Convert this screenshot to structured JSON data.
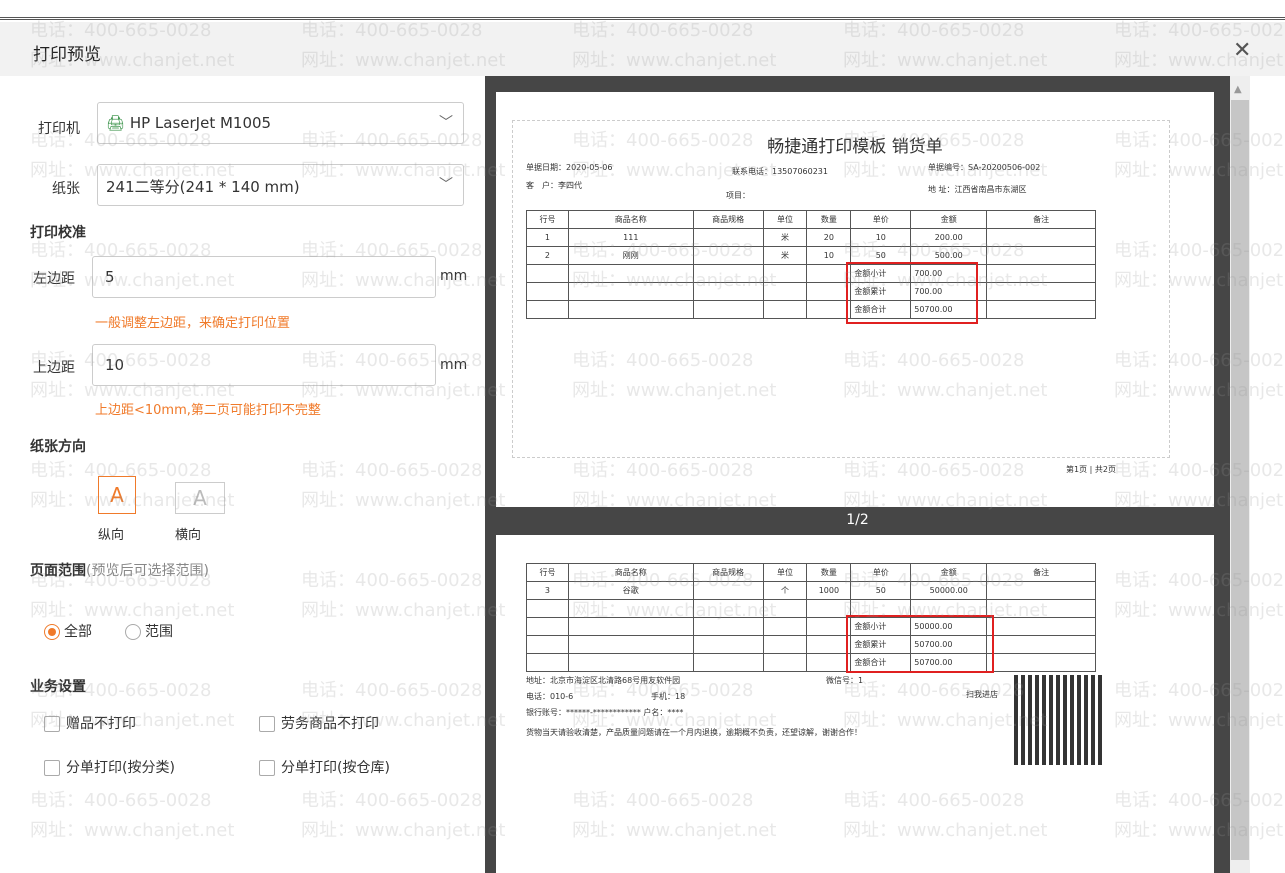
{
  "dialog": {
    "title": "打印预览",
    "close_icon": "close-icon"
  },
  "watermark": {
    "line1": "电话：400-665-0028",
    "line2": "网址：www.chanjet.net"
  },
  "settings": {
    "printer_label": "打印机",
    "printer_value": "HP LaserJet M1005",
    "paper_label": "纸张",
    "paper_value": "241二等分(241 * 140 mm)",
    "calibration_title": "打印校准",
    "left_margin_label": "左边距",
    "left_margin_value": "5",
    "left_margin_unit": "mm",
    "left_margin_hint": "一般调整左边距，来确定打印位置",
    "top_margin_label": "上边距",
    "top_margin_value": "10",
    "top_margin_unit": "mm",
    "top_margin_hint": "上边距<10mm,第二页可能打印不完整",
    "orientation_title": "纸张方向",
    "portrait_label": "纵向",
    "landscape_label": "横向",
    "orientation_glyph": "A",
    "orientation_selected": "portrait",
    "range_title": "页面范围",
    "range_note": "(预览后可选择范围)",
    "range_all": "全部",
    "range_custom": "范围",
    "range_selected": "all",
    "business_title": "业务设置",
    "options": [
      {
        "label": "赠品不打印",
        "checked": false
      },
      {
        "label": "劳务商品不打印",
        "checked": false
      },
      {
        "label": "分单打印(按分类)",
        "checked": false
      },
      {
        "label": "分单打印(按仓库)",
        "checked": false
      }
    ]
  },
  "preview": {
    "page_indicator": "1/2",
    "doc_title": "畅捷通打印模板 销货单",
    "date": "单据日期：2020-05-06",
    "phone": "联系电话：13507060231",
    "doc_no": "单据编号：SA-20200506-002",
    "customer": "客　户：李四代",
    "address": "地 址：江西省南昌市东湖区",
    "project": "项目：",
    "headers": [
      "行号",
      "商品名称",
      "商品规格",
      "单位",
      "数量",
      "单价",
      "金额",
      "备注"
    ],
    "page1_rows": [
      [
        "1",
        "111",
        "",
        "米",
        "20",
        "10",
        "200.00",
        ""
      ],
      [
        "2",
        "刚刚",
        "",
        "米",
        "10",
        "50",
        "500.00",
        ""
      ]
    ],
    "page1_totals": [
      [
        "金额小计",
        "700.00"
      ],
      [
        "金额累计",
        "700.00"
      ],
      [
        "金额合计",
        "50700.00"
      ]
    ],
    "page1_footer": "第1页 | 共2页",
    "page2_rows": [
      [
        "3",
        "谷歌",
        "",
        "个",
        "1000",
        "50",
        "50000.00",
        ""
      ]
    ],
    "page2_totals": [
      [
        "金额小计",
        "50000.00"
      ],
      [
        "金额累计",
        "50700.00"
      ],
      [
        "金额合计",
        "50700.00"
      ]
    ],
    "footer_address": "地址：北京市海淀区北清路68号用友软件园",
    "footer_wechat": "微信号：1",
    "footer_phone": "电话：010-6",
    "footer_mobile": "手机：18",
    "footer_bank": "银行账号：******-************  户名：****",
    "footer_note": "货物当天请验收清楚，产品质量问题请在一个月内退换，逾期概不负责，还望谅解，谢谢合作！",
    "qr_label": "扫我进店"
  }
}
